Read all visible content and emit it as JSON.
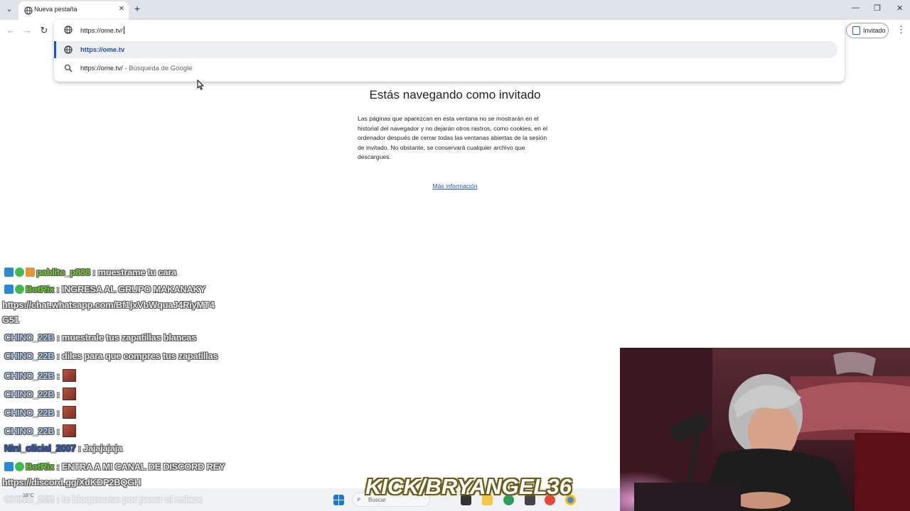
{
  "browser": {
    "tab": {
      "title": "Nueva pestaña",
      "close_glyph": "✕"
    },
    "newtab_glyph": "+",
    "window_controls": {
      "minimize": "—",
      "maximize": "❐",
      "close": "✕"
    },
    "toolbar": {
      "back": "←",
      "forward": "→",
      "reload": "↻",
      "profile_label": "Invitado",
      "menu_glyph": "⋮"
    },
    "omnibox": {
      "value": "https://ome.tv/",
      "suggestions": [
        {
          "text": "https://ome.tv",
          "icon": "globe-icon",
          "selected": true
        },
        {
          "text": "https://ome.tv/",
          "suffix": " - Búsqueda de Google",
          "icon": "search-icon",
          "selected": false
        }
      ]
    }
  },
  "guest_page": {
    "title": "Estás navegando como invitado",
    "body": "Las páginas que aparezcan en esta ventana no se mostrarán en el historial del navegador y no dejarán otros rastros, como cookies, en el ordenador después de cerrar todas las ventanas abiertas de la sesión de invitado. No obstante, se conservará cualquier archivo que descargues.",
    "link": "Más información"
  },
  "chat": {
    "messages": [
      {
        "user": "pablito_p888",
        "text": " : muestrame tu cara",
        "badges": [
          "blue",
          "green",
          "orange"
        ],
        "cls": "pablo"
      },
      {
        "user": "BotRix",
        "text": " : INGRESA AL GRUPO MAKANAKY",
        "badges": [
          "blue",
          "green"
        ],
        "cls": "botrix"
      },
      {
        "user": "",
        "text": "https://chat.whatsapp.com/Bf1jxVbWquaJ4RiyMT4",
        "badges": [],
        "cls": ""
      },
      {
        "user": "",
        "text": "G51",
        "badges": [],
        "cls": ""
      },
      {
        "user": "CHINO_22B",
        "text": " : muestrale tus zapatillas blancas",
        "badges": [],
        "cls": ""
      },
      {
        "user": "CHINO_22B",
        "text": " : diles para que compres tus zapatillas",
        "badges": [],
        "cls": ""
      },
      {
        "user": "CHINO_22B",
        "text": " :",
        "badges": [],
        "cls": "",
        "emote": true
      },
      {
        "user": "CHINO_22B",
        "text": " :",
        "badges": [],
        "cls": "",
        "emote": true
      },
      {
        "user": "CHINO_22B",
        "text": " :",
        "badges": [],
        "cls": "",
        "emote": true
      },
      {
        "user": "CHINO_22B",
        "text": " :",
        "badges": [],
        "cls": "",
        "emote": true
      },
      {
        "user": "Nini_oficial_2007",
        "text": " : Jajajajaja",
        "badges": [],
        "cls": "nini"
      },
      {
        "user": "BotRix",
        "text": " : ENTRA A MI CANAL DE DISCORD REY",
        "badges": [
          "blue",
          "green"
        ],
        "cls": "botrix"
      },
      {
        "user": "",
        "text": "https://discord.gg/XdKDP2BQGH",
        "badges": [],
        "cls": ""
      },
      {
        "user": "CHINO_22B",
        "text": " : te bloquearon por pasar el enlace",
        "badges": [],
        "cls": ""
      }
    ]
  },
  "overlay": {
    "watermark": "KICK/BRYANGEL36",
    "taskbar_search": "Buscar",
    "weather": "18°C"
  },
  "colors": {
    "accent": "#1a56c8",
    "tabstrip": "#dfe3eb",
    "botrix": "#5fd11f",
    "chino": "#a9c6e8"
  }
}
